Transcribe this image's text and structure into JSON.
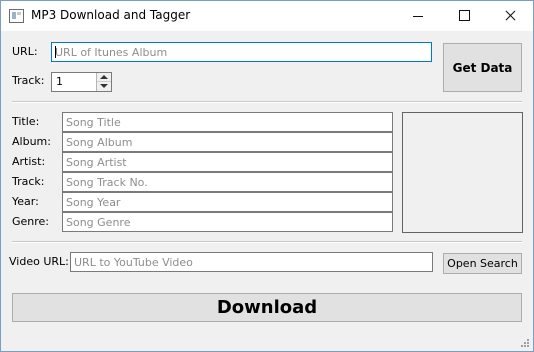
{
  "window": {
    "title": "MP3 Download and Tagger"
  },
  "itunes": {
    "url_label": "URL:",
    "url_placeholder": "URL of Itunes Album",
    "track_label": "Track:",
    "track_value": "1",
    "get_data_label": "Get Data"
  },
  "tags": {
    "fields": [
      {
        "label": "Title:",
        "placeholder": "Song Title"
      },
      {
        "label": "Album:",
        "placeholder": "Song Album"
      },
      {
        "label": "Artist:",
        "placeholder": "Song Artist"
      },
      {
        "label": "Track:",
        "placeholder": "Song Track No."
      },
      {
        "label": "Year:",
        "placeholder": "Song Year"
      },
      {
        "label": "Genre:",
        "placeholder": "Song Genre"
      }
    ]
  },
  "video": {
    "label": "Video URL:",
    "placeholder": "URL to YouTube Video",
    "open_search_label": "Open Search"
  },
  "download_label": "Download"
}
